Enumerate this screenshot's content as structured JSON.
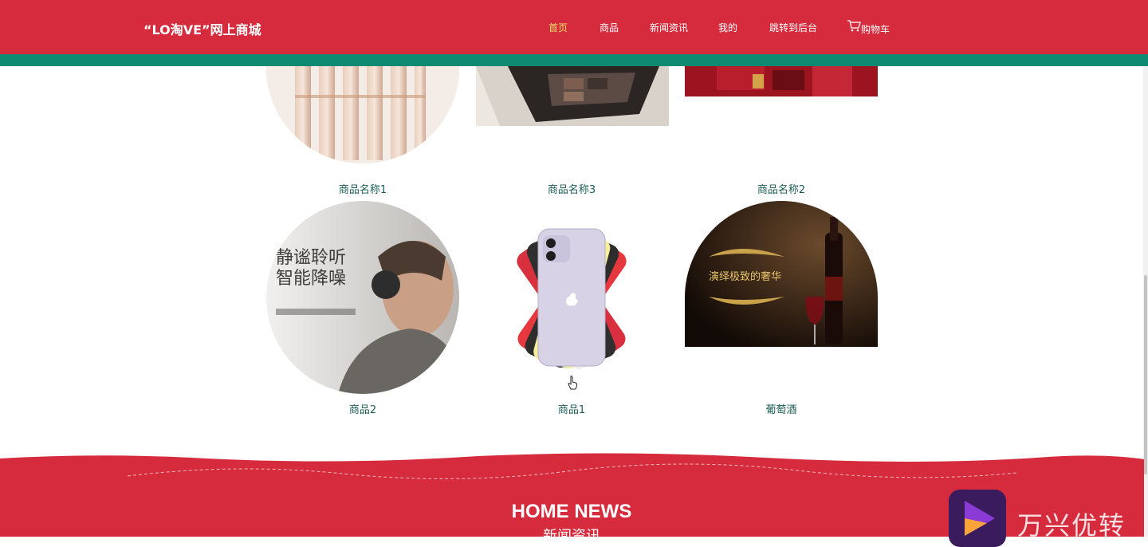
{
  "header": {
    "brand": "“LO淘VE”网上商城",
    "nav": [
      {
        "label": "首页",
        "active": true
      },
      {
        "label": "商品",
        "active": false
      },
      {
        "label": "新闻资讯",
        "active": false
      },
      {
        "label": "我的",
        "active": false
      },
      {
        "label": "跳转到后台",
        "active": false
      }
    ],
    "cart_label": "购物车"
  },
  "products": [
    {
      "name": "商品名称1",
      "image": "lipstick-tubes"
    },
    {
      "name": "商品名称3",
      "image": "eyeshadow-palette"
    },
    {
      "name": "商品名称2",
      "image": "red-gift-box"
    },
    {
      "name": "商品2",
      "image": "headphones-ad",
      "image_text": [
        "静谧聆听",
        "智能降噪"
      ]
    },
    {
      "name": "商品1",
      "image": "colorful-phones"
    },
    {
      "name": "葡萄酒",
      "image": "wine-bottle-ad",
      "image_text": [
        "演绎极致的奢华"
      ]
    }
  ],
  "news": {
    "title": "HOME NEWS",
    "subtitle": "新闻资讯"
  },
  "watermark": {
    "text": "万兴优转"
  },
  "colors": {
    "header_red": "#d52b3c",
    "teal_strip": "#0f8a72",
    "active_nav": "#f7e26b",
    "product_name": "#1b5e55"
  }
}
